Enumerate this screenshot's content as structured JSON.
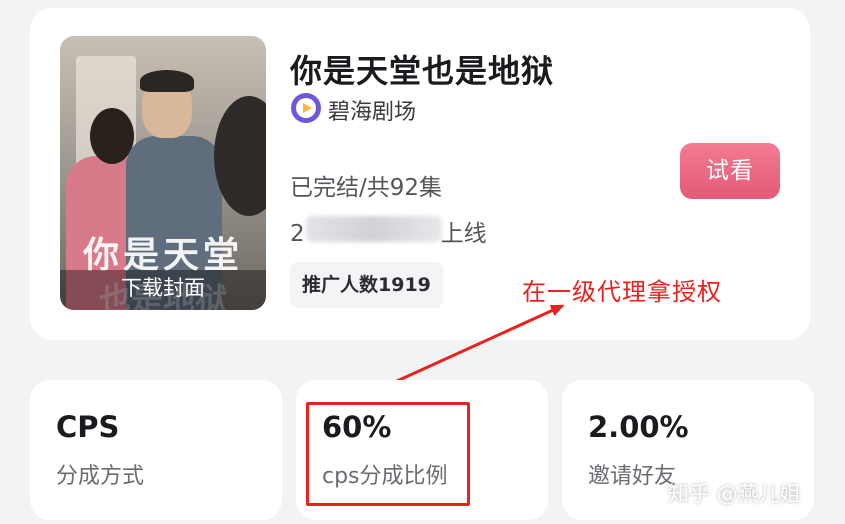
{
  "drama": {
    "title": "你是天堂也是地狱",
    "provider": "碧海剧场",
    "status": "已完结/共92集",
    "release_prefix": "2",
    "release_suffix": "上线",
    "promoters": "推广人数1919",
    "trial_label": "试看",
    "cover": {
      "watermark": "你是天堂",
      "watermark_second": "也是地狱",
      "download_label": "下载封面"
    }
  },
  "annotation": "在一级代理拿授权",
  "stats": [
    {
      "value": "CPS",
      "label": "分成方式"
    },
    {
      "value": "60%",
      "label": "cps分成比例"
    },
    {
      "value": "2.00%",
      "label": "邀请好友"
    }
  ],
  "watermark": "知乎 @燕儿姐",
  "colors": {
    "accent": "#e35a77",
    "annotation": "#e8231e",
    "provider_icon": "#6f57d9"
  }
}
